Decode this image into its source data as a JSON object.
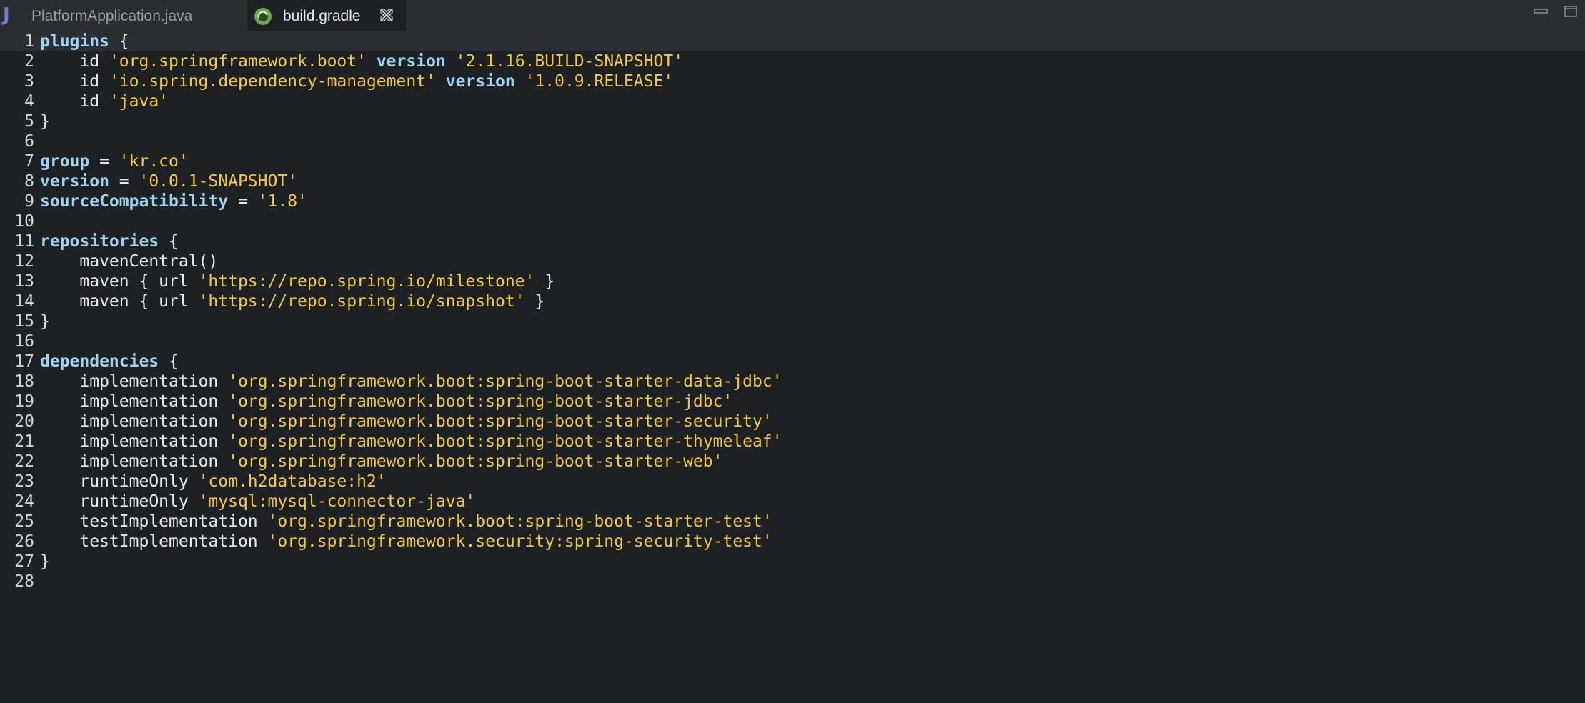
{
  "tabs": [
    {
      "label": "PlatformApplication.java",
      "icon": "java-file-icon",
      "active": false
    },
    {
      "label": "build.gradle",
      "icon": "gradle-icon",
      "active": true
    }
  ],
  "colors": {
    "background": "#1e2124",
    "tabbar": "#2a2d31",
    "keyword": "#9fd3ef",
    "string": "#f3c846",
    "text": "#e6e8eb",
    "current_line": "#2b2e33"
  },
  "editor": {
    "current_line": 1,
    "lines": [
      {
        "n": "1",
        "t": [
          {
            "k": "kw",
            "s": "plugins"
          },
          {
            "k": "plain",
            "s": " {"
          }
        ]
      },
      {
        "n": "2",
        "t": [
          {
            "k": "plain",
            "s": "    id "
          },
          {
            "k": "str",
            "s": "'org.springframework.boot'"
          },
          {
            "k": "plain",
            "s": " "
          },
          {
            "k": "kw",
            "s": "version"
          },
          {
            "k": "plain",
            "s": " "
          },
          {
            "k": "str",
            "s": "'2.1.16.BUILD-SNAPSHOT'"
          }
        ]
      },
      {
        "n": "3",
        "t": [
          {
            "k": "plain",
            "s": "    id "
          },
          {
            "k": "str",
            "s": "'io.spring.dependency-management'"
          },
          {
            "k": "plain",
            "s": " "
          },
          {
            "k": "kw",
            "s": "version"
          },
          {
            "k": "plain",
            "s": " "
          },
          {
            "k": "str",
            "s": "'1.0.9.RELEASE'"
          }
        ]
      },
      {
        "n": "4",
        "t": [
          {
            "k": "plain",
            "s": "    id "
          },
          {
            "k": "str",
            "s": "'java'"
          }
        ]
      },
      {
        "n": "5",
        "t": [
          {
            "k": "plain",
            "s": "}"
          }
        ]
      },
      {
        "n": "6",
        "t": []
      },
      {
        "n": "7",
        "t": [
          {
            "k": "kw",
            "s": "group"
          },
          {
            "k": "plain",
            "s": " = "
          },
          {
            "k": "str",
            "s": "'kr.co'"
          }
        ]
      },
      {
        "n": "8",
        "t": [
          {
            "k": "kw",
            "s": "version"
          },
          {
            "k": "plain",
            "s": " = "
          },
          {
            "k": "str",
            "s": "'0.0.1-SNAPSHOT'"
          }
        ]
      },
      {
        "n": "9",
        "t": [
          {
            "k": "kw",
            "s": "sourceCompatibility"
          },
          {
            "k": "plain",
            "s": " = "
          },
          {
            "k": "str",
            "s": "'1.8'"
          }
        ]
      },
      {
        "n": "10",
        "t": []
      },
      {
        "n": "11",
        "t": [
          {
            "k": "kw",
            "s": "repositories"
          },
          {
            "k": "plain",
            "s": " {"
          }
        ]
      },
      {
        "n": "12",
        "t": [
          {
            "k": "plain",
            "s": "    mavenCentral()"
          }
        ]
      },
      {
        "n": "13",
        "t": [
          {
            "k": "plain",
            "s": "    maven { url "
          },
          {
            "k": "str",
            "s": "'https://repo.spring.io/milestone'"
          },
          {
            "k": "plain",
            "s": " }"
          }
        ]
      },
      {
        "n": "14",
        "t": [
          {
            "k": "plain",
            "s": "    maven { url "
          },
          {
            "k": "str",
            "s": "'https://repo.spring.io/snapshot'"
          },
          {
            "k": "plain",
            "s": " }"
          }
        ]
      },
      {
        "n": "15",
        "t": [
          {
            "k": "plain",
            "s": "}"
          }
        ]
      },
      {
        "n": "16",
        "t": []
      },
      {
        "n": "17",
        "t": [
          {
            "k": "kw",
            "s": "dependencies"
          },
          {
            "k": "plain",
            "s": " {"
          }
        ]
      },
      {
        "n": "18",
        "t": [
          {
            "k": "plain",
            "s": "    implementation "
          },
          {
            "k": "str",
            "s": "'org.springframework.boot:spring-boot-starter-data-jdbc'"
          }
        ]
      },
      {
        "n": "19",
        "t": [
          {
            "k": "plain",
            "s": "    implementation "
          },
          {
            "k": "str",
            "s": "'org.springframework.boot:spring-boot-starter-jdbc'"
          }
        ]
      },
      {
        "n": "20",
        "t": [
          {
            "k": "plain",
            "s": "    implementation "
          },
          {
            "k": "str",
            "s": "'org.springframework.boot:spring-boot-starter-security'"
          }
        ]
      },
      {
        "n": "21",
        "t": [
          {
            "k": "plain",
            "s": "    implementation "
          },
          {
            "k": "str",
            "s": "'org.springframework.boot:spring-boot-starter-thymeleaf'"
          }
        ]
      },
      {
        "n": "22",
        "t": [
          {
            "k": "plain",
            "s": "    implementation "
          },
          {
            "k": "str",
            "s": "'org.springframework.boot:spring-boot-starter-web'"
          }
        ]
      },
      {
        "n": "23",
        "t": [
          {
            "k": "plain",
            "s": "    runtimeOnly "
          },
          {
            "k": "str",
            "s": "'com.h2database:h2'"
          }
        ]
      },
      {
        "n": "24",
        "t": [
          {
            "k": "plain",
            "s": "    runtimeOnly "
          },
          {
            "k": "str",
            "s": "'mysql:mysql-connector-java'"
          }
        ]
      },
      {
        "n": "25",
        "t": [
          {
            "k": "plain",
            "s": "    testImplementation "
          },
          {
            "k": "str",
            "s": "'org.springframework.boot:spring-boot-starter-test'"
          }
        ]
      },
      {
        "n": "26",
        "t": [
          {
            "k": "plain",
            "s": "    testImplementation "
          },
          {
            "k": "str",
            "s": "'org.springframework.security:spring-security-test'"
          }
        ]
      },
      {
        "n": "27",
        "t": [
          {
            "k": "plain",
            "s": "}"
          }
        ]
      },
      {
        "n": "28",
        "t": []
      }
    ]
  }
}
